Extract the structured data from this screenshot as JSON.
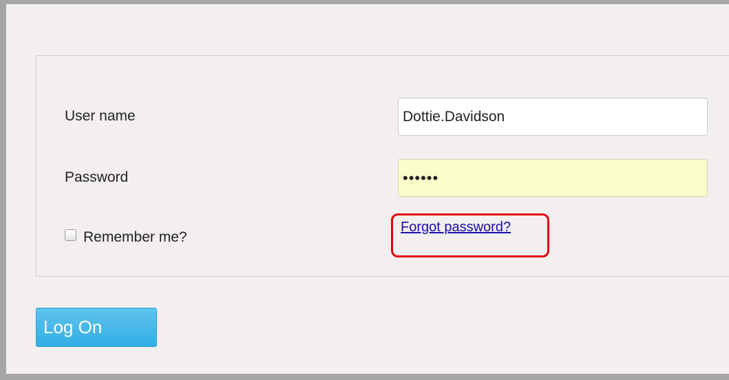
{
  "form": {
    "username_label": "User name",
    "username_value": "Dottie.Davidson",
    "password_label": "Password",
    "password_value": "••••••",
    "remember_label": "Remember me?",
    "remember_checked": false,
    "forgot_link": "Forgot password?",
    "logon_button": "Log On"
  },
  "colors": {
    "background": "#f2efee",
    "autofill_background": "#fafdc7",
    "button": "#33aee4",
    "link": "#1a0dab",
    "highlight": "#e3000f"
  }
}
